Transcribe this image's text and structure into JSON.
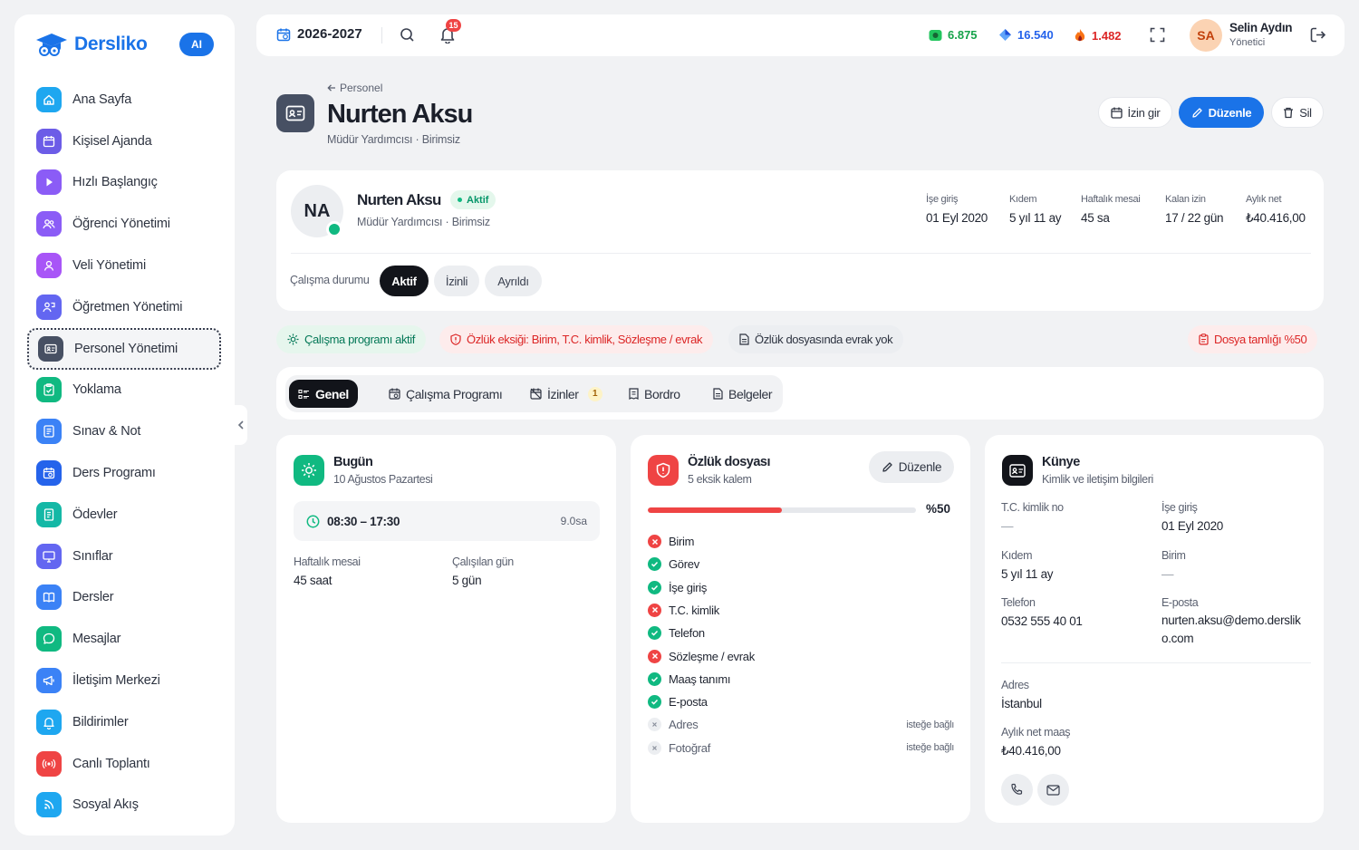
{
  "sidebar": {
    "logo": "Dersliko",
    "ai_badge": "AI",
    "items": [
      {
        "label": "Ana Sayfa",
        "icon": "home-icon",
        "color": "#1ea7f0"
      },
      {
        "label": "Kişisel Ajanda",
        "icon": "calendar-icon",
        "color": "#6c5ce7"
      },
      {
        "label": "Hızlı Başlangıç",
        "icon": "play-icon",
        "color": "#8b5cf6"
      },
      {
        "label": "Öğrenci Yönetimi",
        "icon": "users-icon",
        "color": "#8b5cf6"
      },
      {
        "label": "Veli Yönetimi",
        "icon": "user-group-icon",
        "color": "#a855f7"
      },
      {
        "label": "Öğretmen Yönetimi",
        "icon": "teacher-icon",
        "color": "#6366f1"
      },
      {
        "label": "Personel Yönetimi",
        "icon": "id-card-icon",
        "color": "#475063"
      },
      {
        "label": "Yoklama",
        "icon": "clipboard-check-icon",
        "color": "#10b981"
      },
      {
        "label": "Sınav & Not",
        "icon": "exam-icon",
        "color": "#3b82f6"
      },
      {
        "label": "Ders Programı",
        "icon": "schedule-icon",
        "color": "#2563eb"
      },
      {
        "label": "Ödevler",
        "icon": "homework-icon",
        "color": "#14b8a6"
      },
      {
        "label": "Sınıflar",
        "icon": "monitor-icon",
        "color": "#6366f1"
      },
      {
        "label": "Dersler",
        "icon": "book-icon",
        "color": "#3b82f6"
      },
      {
        "label": "Mesajlar",
        "icon": "message-icon",
        "color": "#10b981"
      },
      {
        "label": "İletişim Merkezi",
        "icon": "megaphone-icon",
        "color": "#3b82f6"
      },
      {
        "label": "Bildirimler",
        "icon": "bell-icon",
        "color": "#1ea7f0"
      },
      {
        "label": "Canlı Toplantı",
        "icon": "broadcast-icon",
        "color": "#ef4444"
      },
      {
        "label": "Sosyal Akış",
        "icon": "rss-icon",
        "color": "#1ea7f0"
      }
    ]
  },
  "topbar": {
    "year": "2026-2027",
    "notification_count": "15",
    "stats": [
      {
        "value": "6.875",
        "color": "#16a34a",
        "icon": "money-icon"
      },
      {
        "value": "16.540",
        "color": "#2563eb",
        "icon": "diamond-icon"
      },
      {
        "value": "1.482",
        "color": "#dc2626",
        "icon": "fire-icon"
      }
    ],
    "user_initials": "SA",
    "user_name": "Selin Aydın",
    "user_role": "Yönetici"
  },
  "page": {
    "breadcrumb": "Personel",
    "title": "Nurten Aksu",
    "subtitle": "Müdür Yardımcısı · Birimsiz",
    "actions": {
      "leave": "İzin gir",
      "edit": "Düzenle",
      "delete": "Sil"
    }
  },
  "profile": {
    "initials": "NA",
    "name": "Nurten Aksu",
    "status": "Aktif",
    "role": "Müdür Yardımcısı · Birimsiz",
    "facts": [
      {
        "label": "İşe giriş",
        "value": "01 Eyl 2020"
      },
      {
        "label": "Kıdem",
        "value": "5 yıl 11 ay"
      },
      {
        "label": "Haftalık mesai",
        "value": "45 sa"
      },
      {
        "label": "Kalan izin",
        "value": "17 / 22 gün"
      },
      {
        "label": "Aylık net",
        "value": "₺40.416,00"
      }
    ],
    "work_status_label": "Çalışma durumu",
    "work_status_options": [
      "Aktif",
      "İzinli",
      "Ayrıldı"
    ]
  },
  "chips": {
    "program": "Çalışma programı aktif",
    "missing": "Özlük eksiği: Birim, T.C. kimlik, Sözleşme / evrak",
    "no_docs": "Özlük dosyasında evrak yok",
    "completeness": "Dosya tamlığı %50"
  },
  "tabs": [
    {
      "label": "Genel"
    },
    {
      "label": "Çalışma Programı"
    },
    {
      "label": "İzinler",
      "count": "1"
    },
    {
      "label": "Bordro"
    },
    {
      "label": "Belgeler"
    }
  ],
  "today": {
    "title": "Bugün",
    "date": "10 Ağustos Pazartesi",
    "time": "08:30 – 17:30",
    "hours": "9.0sa",
    "weekly_label": "Haftalık mesai",
    "weekly_value": "45 saat",
    "days_label": "Çalışılan gün",
    "days_value": "5 gün"
  },
  "file": {
    "title": "Özlük dosyası",
    "subtitle": "5 eksik kalem",
    "edit": "Düzenle",
    "progress_percent": 50,
    "progress_label": "%50",
    "optional_label": "isteğe bağlı",
    "items": [
      {
        "label": "Birim",
        "state": "missing"
      },
      {
        "label": "Görev",
        "state": "ok"
      },
      {
        "label": "İşe giriş",
        "state": "ok"
      },
      {
        "label": "T.C. kimlik",
        "state": "missing"
      },
      {
        "label": "Telefon",
        "state": "ok"
      },
      {
        "label": "Sözleşme / evrak",
        "state": "missing"
      },
      {
        "label": "Maaş tanımı",
        "state": "ok"
      },
      {
        "label": "E-posta",
        "state": "ok"
      },
      {
        "label": "Adres",
        "state": "optional"
      },
      {
        "label": "Fotoğraf",
        "state": "optional"
      }
    ]
  },
  "kunye": {
    "title": "Künye",
    "subtitle": "Kimlik ve iletişim bilgileri",
    "tc_label": "T.C. kimlik no",
    "tc_value": "—",
    "start_label": "İşe giriş",
    "start_value": "01 Eyl 2020",
    "seniority_label": "Kıdem",
    "seniority_value": "5 yıl 11 ay",
    "unit_label": "Birim",
    "unit_value": "—",
    "phone_label": "Telefon",
    "phone_value": "0532 555 40 01",
    "email_label": "E-posta",
    "email_value": "nurten.aksu@demo.dersliko.com",
    "address_label": "Adres",
    "address_value": "İstanbul",
    "salary_label": "Aylık net maaş",
    "salary_value": "₺40.416,00"
  }
}
